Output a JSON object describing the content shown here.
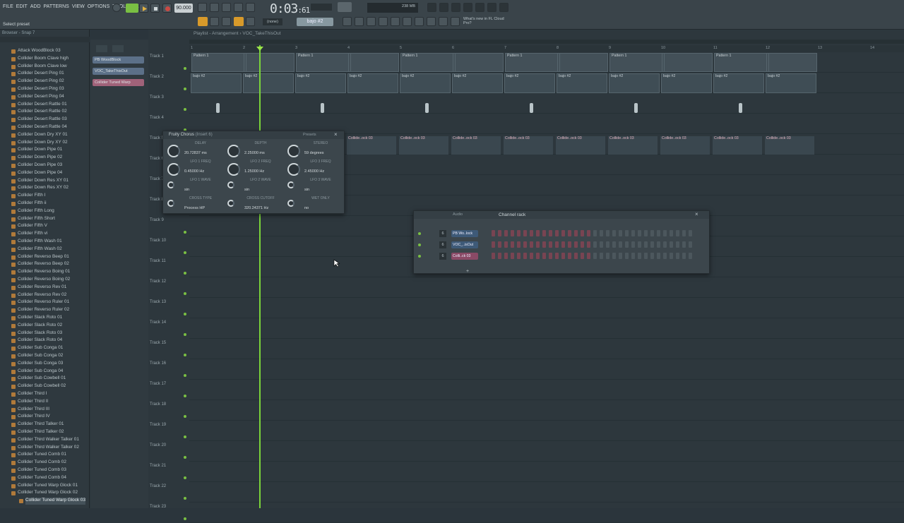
{
  "menu": [
    "FILE",
    "EDIT",
    "ADD",
    "PATTERNS",
    "VIEW",
    "OPTIONS",
    "TOOLS",
    "HELP"
  ],
  "transport": {
    "time": "0:03",
    "time_sub": ":61",
    "tempo": "90.000",
    "pattern": "(none)",
    "pattern_name": "bajo #2",
    "cpu": "238 MB",
    "hint": "Select preset",
    "news": "What's new in FL Cloud Pro?"
  },
  "playlist": {
    "title": "Playlist - Arrangement",
    "breadcrumb": "VOC_TakeThisOut",
    "ruler": [
      "1",
      "2",
      "3",
      "4",
      "5",
      "6",
      "7",
      "8",
      "9",
      "10",
      "11",
      "12",
      "13",
      "14"
    ],
    "tracks": [
      "Track 1",
      "Track 2",
      "Track 3",
      "Track 4",
      "Track 5",
      "Track 6",
      "Track 7",
      "Track 8",
      "Track 9",
      "Track 10",
      "Track 11",
      "Track 12",
      "Track 13",
      "Track 14",
      "Track 15",
      "Track 16",
      "Track 17",
      "Track 18",
      "Track 19",
      "Track 20",
      "Track 21",
      "Track 22",
      "Track 23"
    ],
    "pattern_clip": "Pattern 1",
    "bajo_clip": "bajo #2",
    "vox_clip": "Collide..ock 03"
  },
  "picker": [
    "PB WoodBlock",
    "VOC_TakeThisOut",
    "Collider Tuned Warp"
  ],
  "browser": {
    "title": "Browser - Snap 7",
    "items": [
      "Attack WoodBlock 03",
      "Collider Boom Clave high",
      "Collider Boom Clave low",
      "Collider Desert Ping 01",
      "Collider Desert Ping 02",
      "Collider Desert Ping 03",
      "Collider Desert Ping 04",
      "Collider Desert Rattle 01",
      "Collider Desert Rattle 02",
      "Collider Desert Rattle 03",
      "Collider Desert Rattle 04",
      "Collider Down Dry XY 01",
      "Collider Down Dry XY 02",
      "Collider Down Pipe 01",
      "Collider Down Pipe 02",
      "Collider Down Pipe 03",
      "Collider Down Pipe 04",
      "Collider Down Res XY 01",
      "Collider Down Res XY 02",
      "Collider Fifth I",
      "Collider Fifth ii",
      "Collider Fifth Long",
      "Collider Fifth Short",
      "Collider Fifth V",
      "Collider Fifth vi",
      "Collider Fifth Wash 01",
      "Collider Fifth Wash 02",
      "Collider Reverso Beep 01",
      "Collider Reverso Beep 02",
      "Collider Reverso Boing 01",
      "Collider Reverso Boing 02",
      "Collider Reverso Rev 01",
      "Collider Reverso Rev 02",
      "Collider Reverso Ruler 01",
      "Collider Reverso Ruler 02",
      "Collider Slack Roto 01",
      "Collider Slack Roto 02",
      "Collider Slack Roto 03",
      "Collider Slack Roto 04",
      "Collider Sub Conga 01",
      "Collider Sub Conga 02",
      "Collider Sub Conga 03",
      "Collider Sub Conga 04",
      "Collider Sub Cowbell 01",
      "Collider Sub Cowbell 02",
      "Collider Third I",
      "Collider Third II",
      "Collider Third III",
      "Collider Third IV",
      "Collider Third Talker 01",
      "Collider Third Talker 02",
      "Collider Third Walker Talker 01",
      "Collider Third Walker Talker 02",
      "Collider Tuned Comb 01",
      "Collider Tuned Comb 02",
      "Collider Tuned Comb 03",
      "Collider Tuned Comb 04",
      "Collider Tuned Warp Glock 01",
      "Collider Tuned Warp Glock 02",
      "Collider Tuned Warp Glock 03"
    ]
  },
  "chorus": {
    "title": "Fruity Chorus",
    "insert": "(Insert 6)",
    "presets": "Presets",
    "knobs": [
      {
        "label": "DELAY",
        "value": "20.72837 ms"
      },
      {
        "label": "DEPTH",
        "value": "2.25000 ms"
      },
      {
        "label": "STEREO",
        "value": "59 degrees"
      },
      {
        "label": "LFO 1 FREQ",
        "value": "0.45000 Hz"
      },
      {
        "label": "LFO 2 FREQ",
        "value": "1.25000 Hz"
      },
      {
        "label": "LFO 3 FREQ",
        "value": "2.45000 Hz"
      },
      {
        "label": "LFO 1 WAVE",
        "value": "sin"
      },
      {
        "label": "LFO 2 WAVE",
        "value": "sin"
      },
      {
        "label": "LFO 3 WAVE",
        "value": "sin"
      },
      {
        "label": "CROSS TYPE",
        "value": "Process HP"
      },
      {
        "label": "CROSS CUTOFF",
        "value": "320.24371 Hz"
      },
      {
        "label": "WET ONLY",
        "value": "no"
      }
    ]
  },
  "channel_rack": {
    "title": "Channel rack",
    "filter": "Audio",
    "channels": [
      {
        "num": "6",
        "name": "PB Wo..lock",
        "color": "#3e5a78"
      },
      {
        "num": "6",
        "name": "VOC_..isOut",
        "color": "#3e5a78"
      },
      {
        "num": "6",
        "name": "Colli..ck 03",
        "color": "#8a4a66"
      }
    ]
  }
}
